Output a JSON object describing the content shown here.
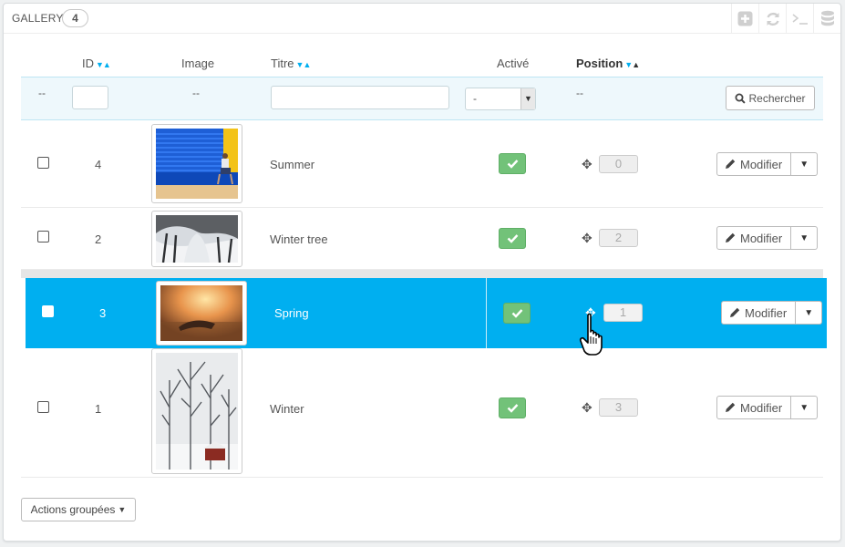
{
  "panel": {
    "title": "Gallery",
    "count": "4",
    "tools": [
      "add-icon",
      "refresh-icon",
      "sql-icon",
      "database-icon"
    ]
  },
  "columns": {
    "id": "ID",
    "image": "Image",
    "title": "Titre",
    "active": "Activé",
    "position": "Position"
  },
  "filters": {
    "bulk_dash": "--",
    "image_dash": "--",
    "position_dash": "--",
    "active_selected": "-",
    "search_label": "Rechercher"
  },
  "rows": [
    {
      "id": "4",
      "title": "Summer",
      "position": "0",
      "edit_label": "Modifier"
    },
    {
      "id": "2",
      "title": "Winter tree",
      "position": "2",
      "edit_label": "Modifier"
    },
    {
      "id": "3",
      "title": "Spring",
      "position": "1",
      "edit_label": "Modifier"
    },
    {
      "id": "1",
      "title": "Winter",
      "position": "3",
      "edit_label": "Modifier"
    }
  ],
  "footer": {
    "bulk_actions_label": "Actions groupées"
  },
  "colors": {
    "accent": "#00aff0",
    "active_green": "#72c279"
  }
}
